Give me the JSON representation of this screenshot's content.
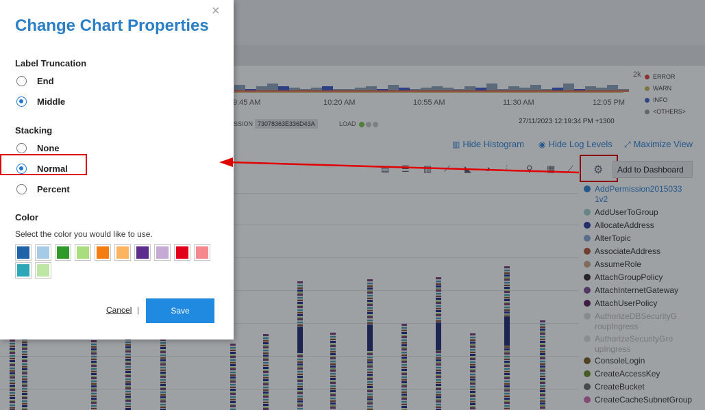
{
  "modal": {
    "title": "Change Chart Properties",
    "close_symbol": "×",
    "label_truncation": {
      "heading": "Label Truncation",
      "options": [
        "End",
        "Middle"
      ],
      "selected": "Middle"
    },
    "stacking": {
      "heading": "Stacking",
      "options": [
        "None",
        "Normal",
        "Percent"
      ],
      "selected": "Normal"
    },
    "color": {
      "heading": "Color",
      "hint": "Select the color you would like to use.",
      "swatches": [
        "#1f64a8",
        "#a6cbe6",
        "#2f9a2a",
        "#a9dd7d",
        "#f47c12",
        "#fdb461",
        "#5d2d8e",
        "#c5aad6",
        "#e2001a",
        "#f5888d",
        "#2ba7b8",
        "#bde6a4"
      ]
    },
    "cancel_label": "Cancel",
    "separator": "|",
    "save_label": "Save"
  },
  "background": {
    "histogram": {
      "scale_label": "2k",
      "time_ticks": [
        "9:45 AM",
        "10:20 AM",
        "10:55 AM",
        "11:30 AM",
        "12:05 PM"
      ],
      "legend": [
        {
          "label": "ERROR",
          "color": "#d9443b"
        },
        {
          "label": "WARN",
          "color": "#c9b24f"
        },
        {
          "label": "INFO",
          "color": "#3f63c6"
        },
        {
          "label": "<OTHERS>",
          "color": "#9a9a9a"
        }
      ]
    },
    "session_label": "SSION",
    "session_id": "73078363E336D43A",
    "load_label": "LOAD",
    "timestamp": "27/11/2023 12:19:34 PM +1300",
    "actions": {
      "hide_histogram": "Hide Histogram",
      "hide_log_levels": "Hide Log Levels",
      "maximize_view": "Maximize View"
    },
    "add_to_dashboard": "Add to Dashboard",
    "chart_legend": [
      {
        "label": "AddPermission2015033",
        "label2": "1v2",
        "color": "#2b7fd2",
        "style": "link"
      },
      {
        "label": "AddUserToGroup",
        "color": "#9ecfcf",
        "style": "normal"
      },
      {
        "label": "AllocateAddress",
        "color": "#2e3a9a",
        "style": "normal"
      },
      {
        "label": "AlterTopic",
        "color": "#8aa6d8",
        "style": "normal"
      },
      {
        "label": "AssociateAddress",
        "color": "#b3533a",
        "style": "normal"
      },
      {
        "label": "AssumeRole",
        "color": "#c9a587",
        "style": "normal"
      },
      {
        "label": "AttachGroupPolicy",
        "color": "#3a2828",
        "style": "normal"
      },
      {
        "label": "AttachInternetGateway",
        "color": "#7a4a8a",
        "style": "normal"
      },
      {
        "label": "AttachUserPolicy",
        "color": "#5a1e5a",
        "style": "normal"
      },
      {
        "label": "AuthorizeDBSecurityG",
        "label2": "roupIngress",
        "color": "#d9d9d9",
        "style": "muted"
      },
      {
        "label": "AuthorizeSecurityGro",
        "label2": "upIngress",
        "color": "#dedede",
        "style": "muted"
      },
      {
        "label": "ConsoleLogin",
        "color": "#7a5a20",
        "style": "normal"
      },
      {
        "label": "CreateAccessKey",
        "color": "#6a8a2a",
        "style": "normal"
      },
      {
        "label": "CreateBucket",
        "color": "#6a6a6a",
        "style": "normal"
      },
      {
        "label": "CreateCacheSubnetGroup",
        "color": "#d36ab0",
        "style": "normal"
      }
    ]
  }
}
